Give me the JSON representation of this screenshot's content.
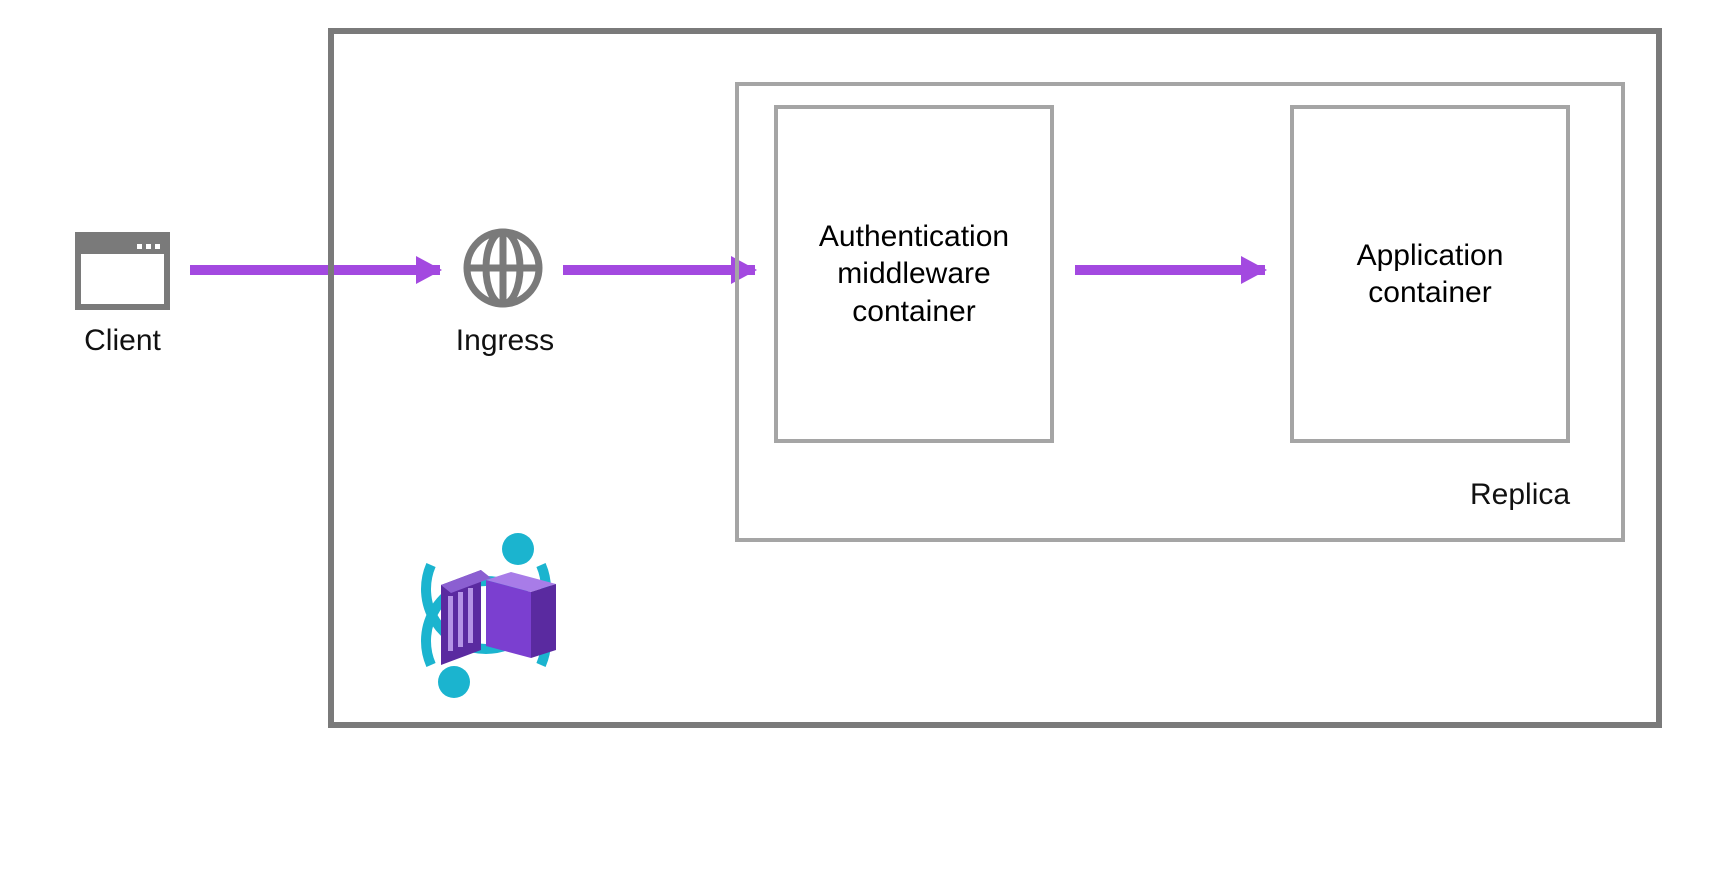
{
  "client": {
    "label": "Client"
  },
  "ingress": {
    "label": "Ingress"
  },
  "replica": {
    "label": "Replica"
  },
  "auth": {
    "label": "Authentication middleware container"
  },
  "app": {
    "label": "Application container"
  },
  "colors": {
    "arrow": "#a349e0",
    "border_dark": "#7a7a7a",
    "border_light": "#a5a5a5",
    "teal": "#1bb4cf",
    "purple": "#6b2fb5"
  }
}
